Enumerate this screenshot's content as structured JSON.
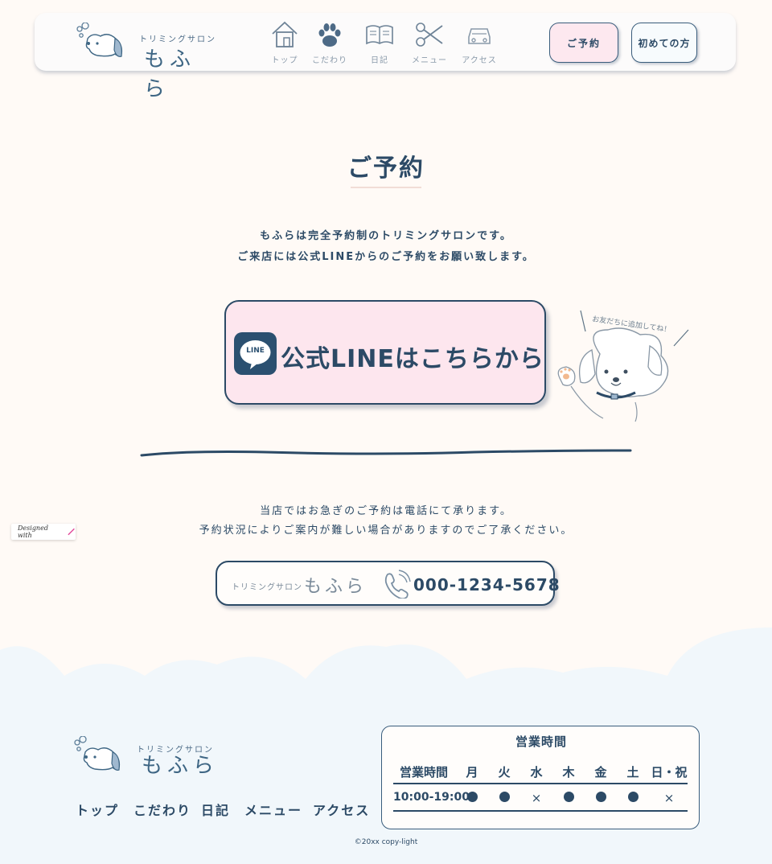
{
  "header": {
    "logo": {
      "small": "トリミングサロン",
      "name": "もふら"
    },
    "nav": [
      {
        "label": "トップ",
        "icon": "house-icon"
      },
      {
        "label": "こだわり",
        "icon": "paw-icon"
      },
      {
        "label": "日記",
        "icon": "book-icon"
      },
      {
        "label": "メニュー",
        "icon": "scissors-icon"
      },
      {
        "label": "アクセス",
        "icon": "car-icon"
      }
    ],
    "reserve_button": "ご予約",
    "first_button": "初めての方"
  },
  "main": {
    "title": "ご予約",
    "intro": [
      "もふらは完全予約制のトリミングサロンです。",
      "ご来店には公式LINEからのご予約をお願い致します。"
    ],
    "line_button": {
      "icon_text": "LINE",
      "label": "公式LINEはこちらから"
    },
    "dog_bubble": "お友だちに追加してね！",
    "tel_note": [
      "当店ではお急ぎのご予約は電話にて承ります。",
      "予約状況によりご案内が難しい場合がありますのでご了承ください。"
    ],
    "tel": {
      "shop_small": "トリミングサロン",
      "shop_name": "もふら",
      "number": "000-1234-5678"
    }
  },
  "badge": "Designed with",
  "footer": {
    "logo": {
      "small": "トリミングサロン",
      "name": "もふら"
    },
    "nav": [
      "トップ",
      "こだわり",
      "日記",
      "メニュー",
      "アクセス"
    ],
    "hours": {
      "title": "営業時間",
      "headers": [
        "営業時間",
        "月",
        "火",
        "水",
        "木",
        "金",
        "土",
        "日・祝"
      ],
      "time": "10:00-19:00",
      "open": [
        true,
        true,
        false,
        true,
        true,
        true,
        false
      ],
      "closed_mark": "×"
    },
    "copyright": "©20xx copy-light"
  },
  "colors": {
    "primary": "#2c4a66",
    "pink": "#fde6ee",
    "background": "#fffaf6",
    "cloud": "#eef6fb"
  }
}
